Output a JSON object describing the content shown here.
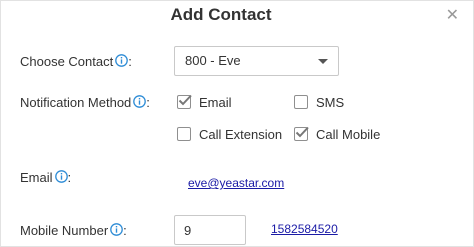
{
  "dialog": {
    "title": "Add Contact",
    "close_symbol": "✕"
  },
  "choose_contact": {
    "label": "Choose Contact",
    "selected": "800 - Eve",
    "icon": "info-icon"
  },
  "notification": {
    "label": "Notification Method",
    "icon": "info-icon",
    "options": {
      "email": {
        "label": "Email",
        "checked": true
      },
      "sms": {
        "label": "SMS",
        "checked": false
      },
      "call_extension": {
        "label": "Call Extension",
        "checked": false
      },
      "call_mobile": {
        "label": "Call Mobile",
        "checked": true
      }
    }
  },
  "email": {
    "label": "Email",
    "value": "eve@yeastar.com",
    "icon": "info-icon"
  },
  "mobile": {
    "label": "Mobile Number",
    "prefix_value": "9",
    "number": "1582584520",
    "icon": "info-icon"
  },
  "colors": {
    "info_icon": "#2e8cd6",
    "check": "#777777",
    "link": "#1a1aa6"
  }
}
